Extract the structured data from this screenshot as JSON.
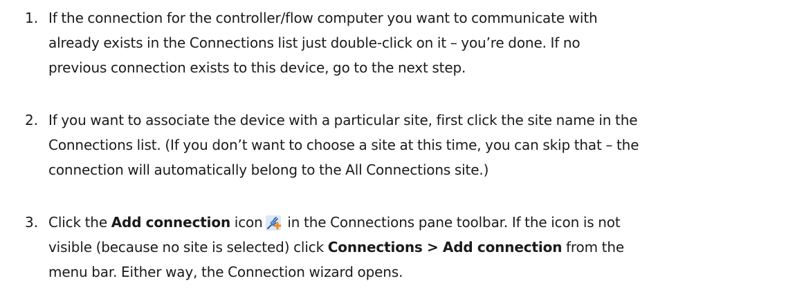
{
  "steps": [
    {
      "number": "1.",
      "lines": [
        "If the connection for the controller/flow computer you want to communicate with",
        "already exists in the Connections list just double-click on it – you’re done. If no",
        "previous connection exists to this device, go to the next step."
      ]
    },
    {
      "number": "2.",
      "lines": [
        "If you want to associate the device with a particular site, first click the site name in the",
        "Connections list. (If you don’t want to choose a site at this time, you can skip that – the",
        "connection will automatically belong to the All Connections site.)"
      ]
    },
    {
      "number": "3.",
      "line1": {
        "pre": "Click the ",
        "bold": "Add connection",
        "mid": " icon",
        "post": " in the Connections pane toolbar. If the icon is not"
      },
      "line2": {
        "pre": "visible (because no site is selected) click ",
        "bold": "Connections > Add connection",
        "post": " from the"
      },
      "line3": "menu bar. Either way, the Connection wizard opens.",
      "icon": "add-connection-icon"
    }
  ],
  "colors": {
    "text": "#1a1a1a",
    "icon_blue": "#2f6fc4",
    "icon_plus": "#f08a1c"
  }
}
